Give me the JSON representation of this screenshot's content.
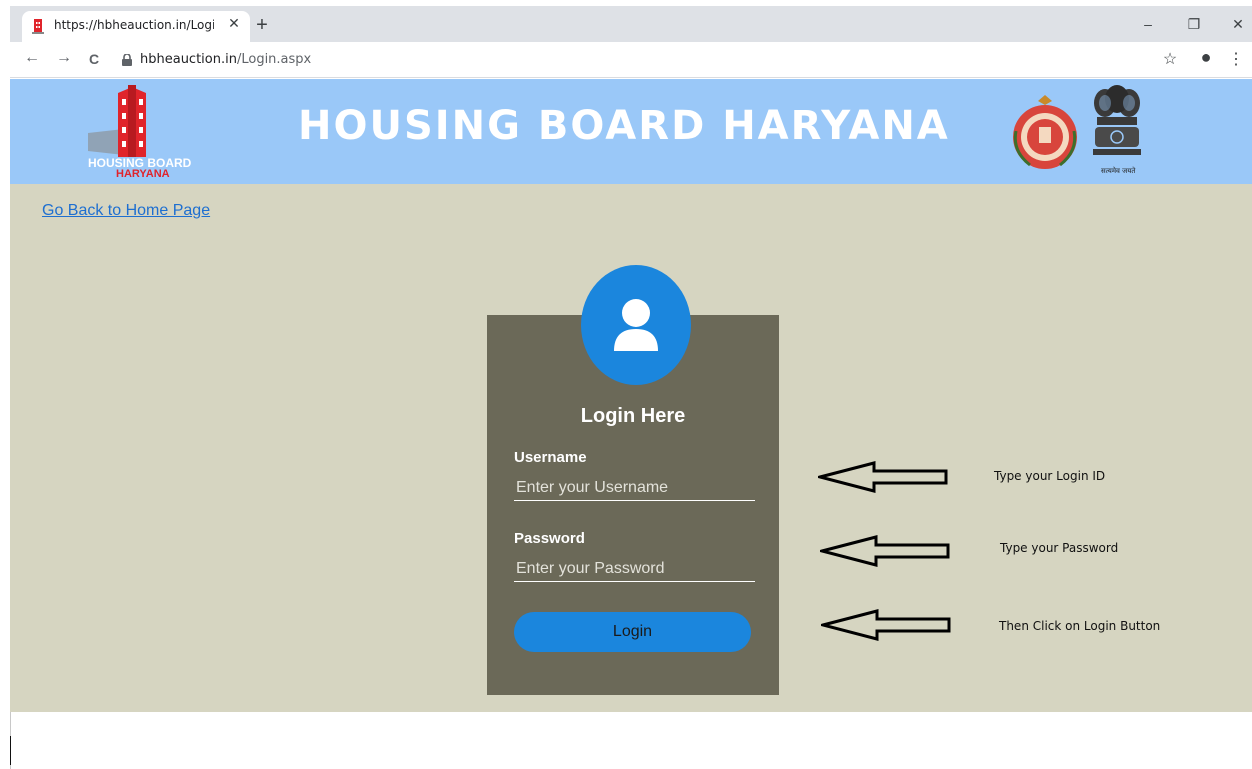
{
  "browser": {
    "tab_title": "https://hbheauction.in/Login.aspx",
    "tab_close": "✕",
    "new_tab": "+",
    "url_host": "hbheauction.in",
    "url_path": "/Login.aspx",
    "window_minimize": "–",
    "window_restore": "❐",
    "window_close": "✕",
    "back": "←",
    "forward": "→",
    "reload": "C",
    "star": "☆",
    "profile": "●",
    "menu": "⋮"
  },
  "header": {
    "title": "HOUSING BOARD HARYANA",
    "logo_line1": "HOUSING BOARD",
    "logo_line2": "HARYANA",
    "emblem_caption": "सत्यमेव जयते"
  },
  "links": {
    "back_home": "Go Back to Home Page"
  },
  "login": {
    "title": "Login Here",
    "username_label": "Username",
    "username_placeholder": "Enter your Username",
    "username_value": "",
    "password_label": "Password",
    "password_placeholder": "Enter your Password",
    "password_value": "",
    "button_label": "Login"
  },
  "annotations": {
    "login_id": "Type your Login ID",
    "password": "Type your Password",
    "button": "Then Click on Login Button"
  },
  "colors": {
    "header_bg": "#9ac8f8",
    "page_bg": "#d6d5c1",
    "login_box": "#6b6958",
    "accent": "#1b86dd"
  }
}
